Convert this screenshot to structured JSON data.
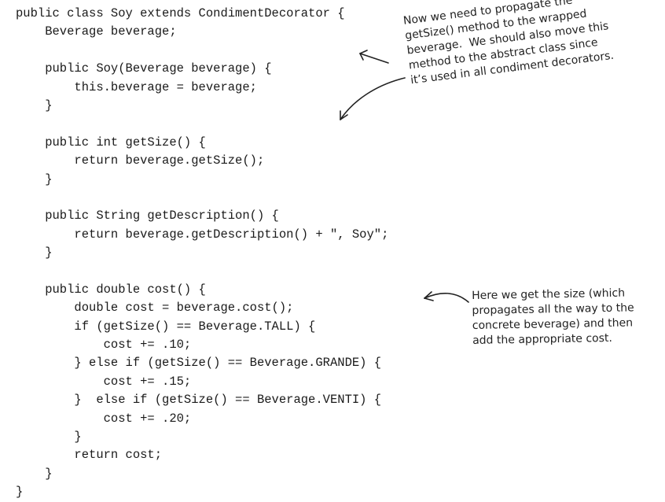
{
  "code_lines": [
    "public class Soy extends CondimentDecorator {",
    "    Beverage beverage;",
    "",
    "    public Soy(Beverage beverage) {",
    "        this.beverage = beverage;",
    "    }",
    "",
    "    public int getSize() {",
    "        return beverage.getSize();",
    "    }",
    "",
    "    public String getDescription() {",
    "        return beverage.getDescription() + \", Soy\";",
    "    }",
    "",
    "    public double cost() {",
    "        double cost = beverage.cost();",
    "        if (getSize() == Beverage.TALL) {",
    "            cost += .10;",
    "        } else if (getSize() == Beverage.GRANDE) {",
    "            cost += .15;",
    "        }  else if (getSize() == Beverage.VENTI) {",
    "            cost += .20;",
    "        }",
    "        return cost;",
    "    }",
    "}"
  ],
  "annotations": {
    "top_note": "Now we need to propagate the\ngetSize() method to the wrapped\nbeverage.  We should also move this\nmethod to the abstract class since\nit’s used in all condiment decorators.",
    "bottom_note": "Here we get the size (which\npropagates all the way to the\nconcrete beverage) and then\nadd the appropriate cost."
  },
  "colors": {
    "text": "#1a1a1a",
    "annotation": "#222222"
  }
}
